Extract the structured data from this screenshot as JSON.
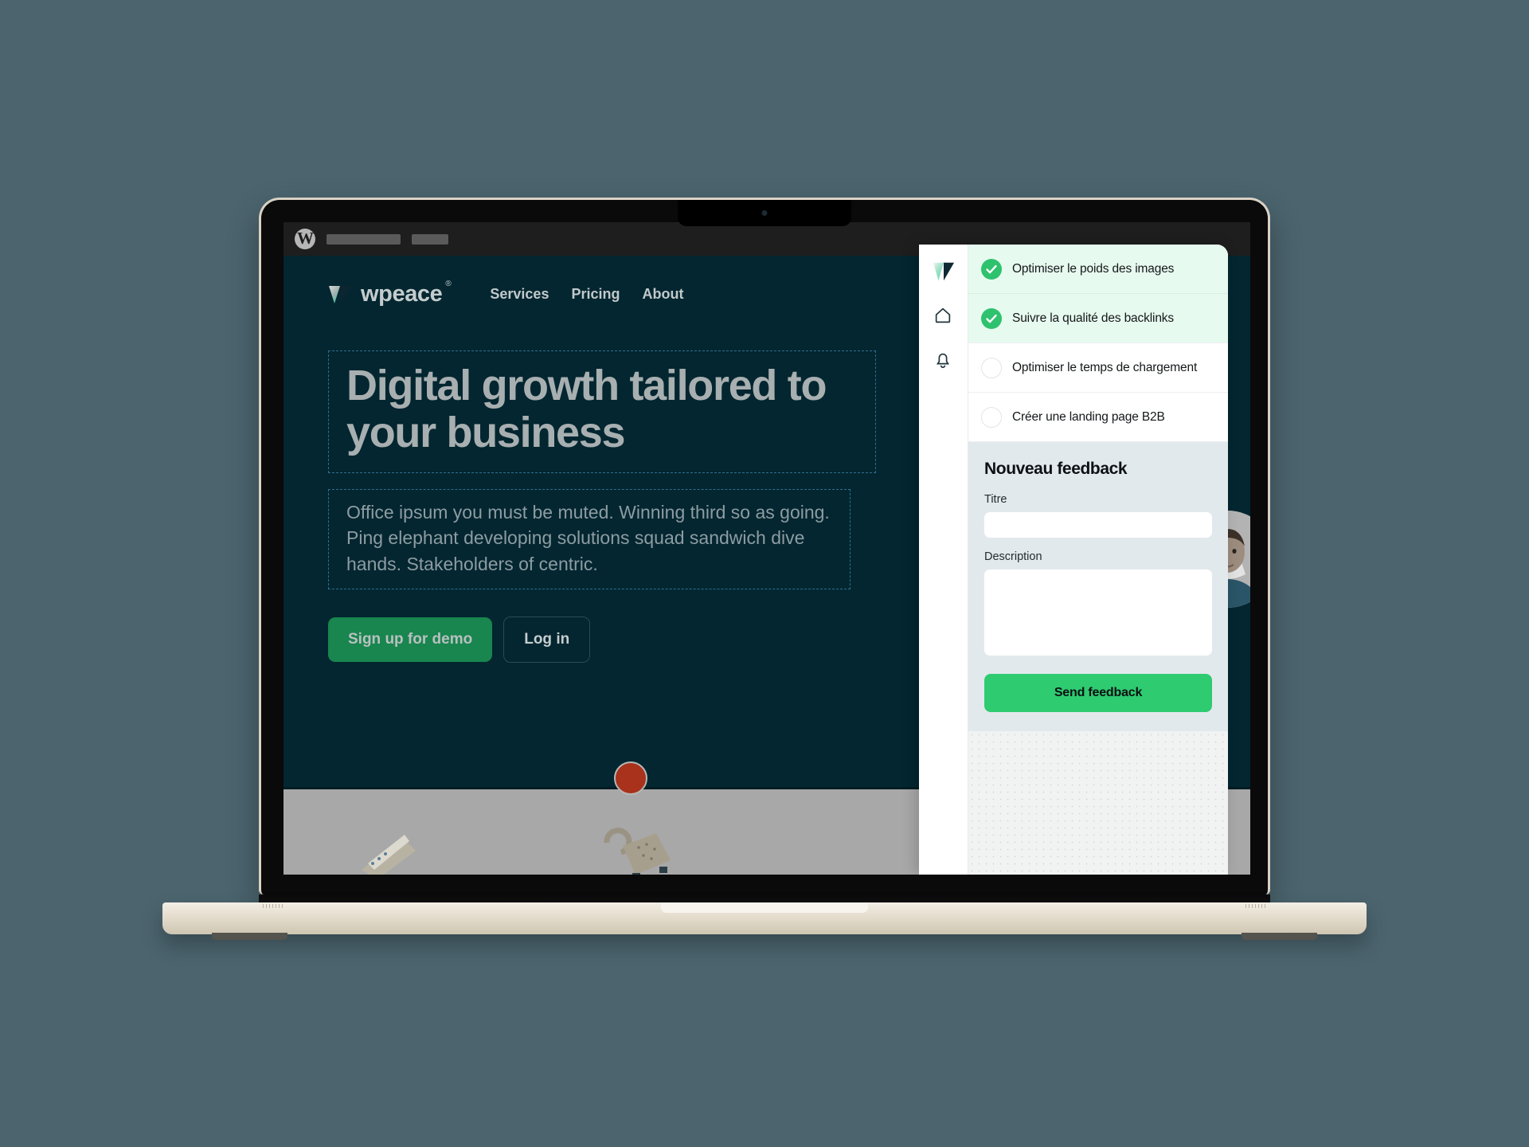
{
  "background_color": "#4b646e",
  "device": {
    "name": "laptop-macbook",
    "body_color": "#e4ddcd",
    "bezel_color": "#0a0a0b"
  },
  "browser_site": {
    "admin_bar": {
      "logo_icon": "wordpress-icon",
      "logo_glyph": "W",
      "placeholder_items": [
        "",
        ""
      ]
    },
    "header": {
      "logo_icon": "wpeace-triangle-logo",
      "brand_name": "wpeace",
      "brand_registered_mark": "®",
      "nav": [
        {
          "label": "Services"
        },
        {
          "label": "Pricing"
        },
        {
          "label": "About"
        }
      ]
    },
    "hero": {
      "title": "Digital growth tailored to your business",
      "subtitle": "Office ipsum you must be muted. Winning third so as going. Ping elephant developing solutions squad sandwich dive hands. Stakeholders of centric.",
      "primary_button": "Sign up for demo",
      "secondary_button": "Log in",
      "avatar_alt": "person-portrait",
      "primary_button_color": "#18864e",
      "selection_outline_color": "#2f6f92"
    },
    "colors": {
      "page_background": "#032630",
      "band_background": "#a8a8a8",
      "text_muted": "#8d9ca2"
    }
  },
  "annotation_markers": {
    "color": "#a8321b",
    "ring_color": "#b7b7b7",
    "count": 4
  },
  "panel": {
    "rail": {
      "items": [
        {
          "icon": "wpeace-triangle-logo",
          "name": "logo"
        },
        {
          "icon": "home-icon",
          "name": "home"
        },
        {
          "icon": "bell-icon",
          "name": "notifications"
        }
      ]
    },
    "tasks": [
      {
        "label": "Optimiser le poids des images",
        "done": true
      },
      {
        "label": "Suivre la qualité des backlinks",
        "done": true
      },
      {
        "label": "Optimiser le temps de chargement",
        "done": false
      },
      {
        "label": "Créer une landing page B2B",
        "done": false
      }
    ],
    "feedback_form": {
      "heading": "Nouveau feedback",
      "title_label": "Titre",
      "title_value": "",
      "title_placeholder": "",
      "description_label": "Description",
      "description_value": "",
      "description_placeholder": "",
      "submit_label": "Send feedback",
      "submit_color": "#2ecb71",
      "form_background": "#e2e9ec"
    },
    "colors": {
      "task_done_background": "#e7faef",
      "check_color": "#2ec26e"
    }
  }
}
